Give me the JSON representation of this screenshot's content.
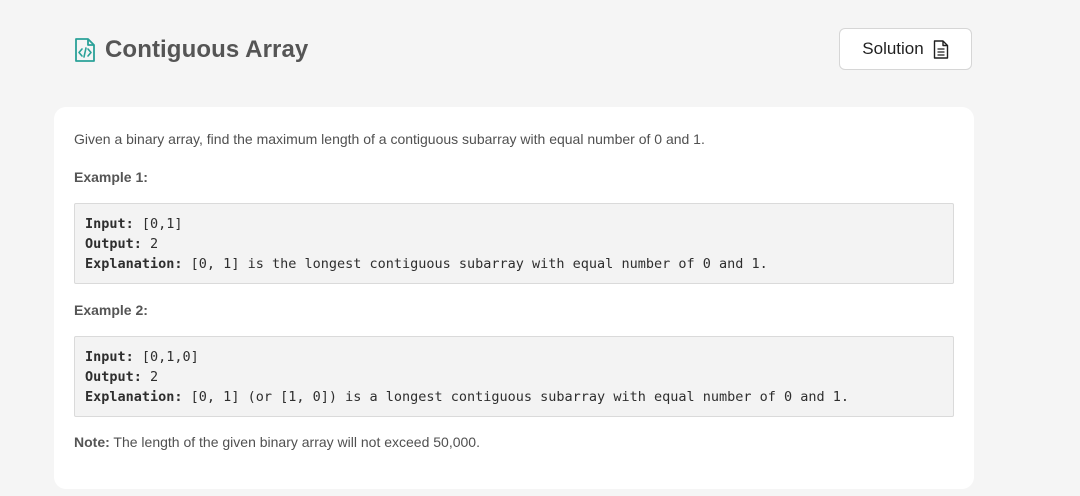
{
  "header": {
    "title": "Contiguous Array",
    "title_icon": "code-file-icon",
    "accent_color": "#2aa198"
  },
  "toolbar": {
    "solution_label": "Solution",
    "solution_icon": "document-icon"
  },
  "problem": {
    "description": "Given a binary array, find the maximum length of a contiguous subarray with equal number of 0 and 1.",
    "examples": [
      {
        "label": "Example 1:",
        "input_key": "Input:",
        "input_value": " [0,1]",
        "output_key": "Output:",
        "output_value": " 2",
        "explanation_key": "Explanation:",
        "explanation_value": " [0, 1] is the longest contiguous subarray with equal number of 0 and 1."
      },
      {
        "label": "Example 2:",
        "input_key": "Input:",
        "input_value": " [0,1,0]",
        "output_key": "Output:",
        "output_value": " 2",
        "explanation_key": "Explanation:",
        "explanation_value": " [0, 1] (or [1, 0]) is a longest contiguous subarray with equal number of 0 and 1."
      }
    ],
    "note_label": "Note:",
    "note_text": " The length of the given binary array will not exceed 50,000."
  }
}
